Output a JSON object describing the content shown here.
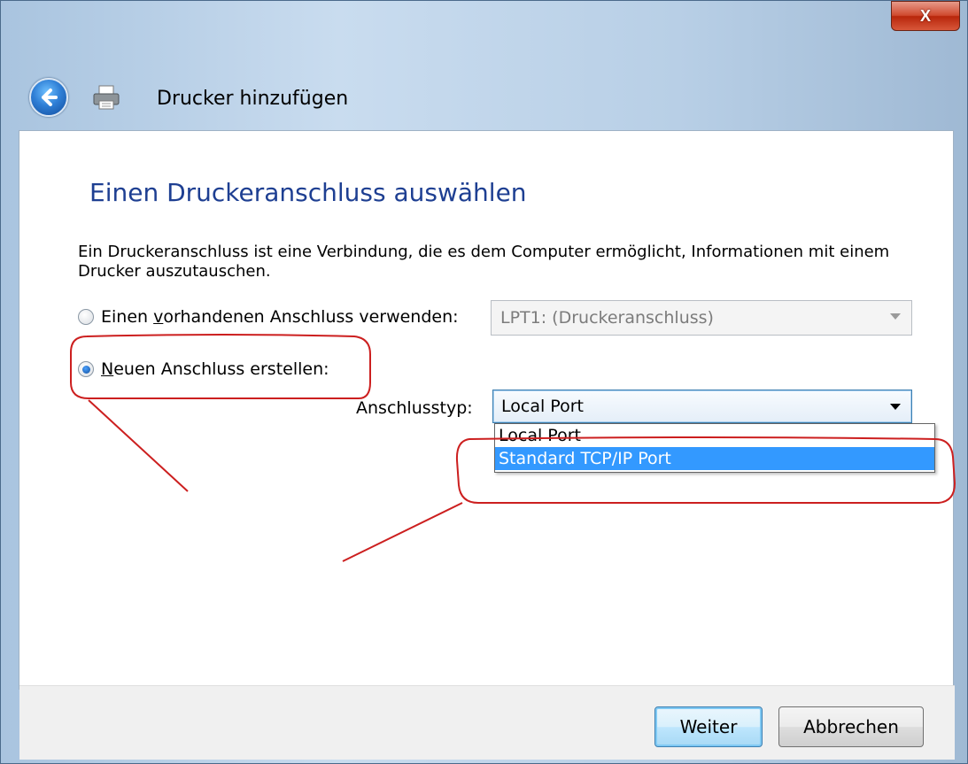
{
  "window": {
    "close_label": "X"
  },
  "nav": {
    "title": "Drucker hinzufügen"
  },
  "page": {
    "heading": "Einen Druckeranschluss auswählen",
    "description": "Ein Druckeranschluss ist eine Verbindung, die es dem Computer ermöglicht, Informationen mit einem Drucker auszutauschen."
  },
  "options": {
    "existing_prefix": "Einen ",
    "existing_mnemonic": "v",
    "existing_suffix": "orhandenen Anschluss verwenden:",
    "existing_port_value": "LPT1: (Druckeranschluss)",
    "new_mnemonic": "N",
    "new_suffix": "euen Anschluss erstellen:",
    "port_type_label": "Anschlusstyp:",
    "port_type_value": "Local Port",
    "port_type_options": [
      "Local Port",
      "Standard TCP/IP Port"
    ]
  },
  "buttons": {
    "next": "Weiter",
    "cancel": "Abbrechen"
  },
  "colors": {
    "heading": "#1e3f92",
    "selection": "#3399ff",
    "annotation": "#cc1f1f"
  }
}
